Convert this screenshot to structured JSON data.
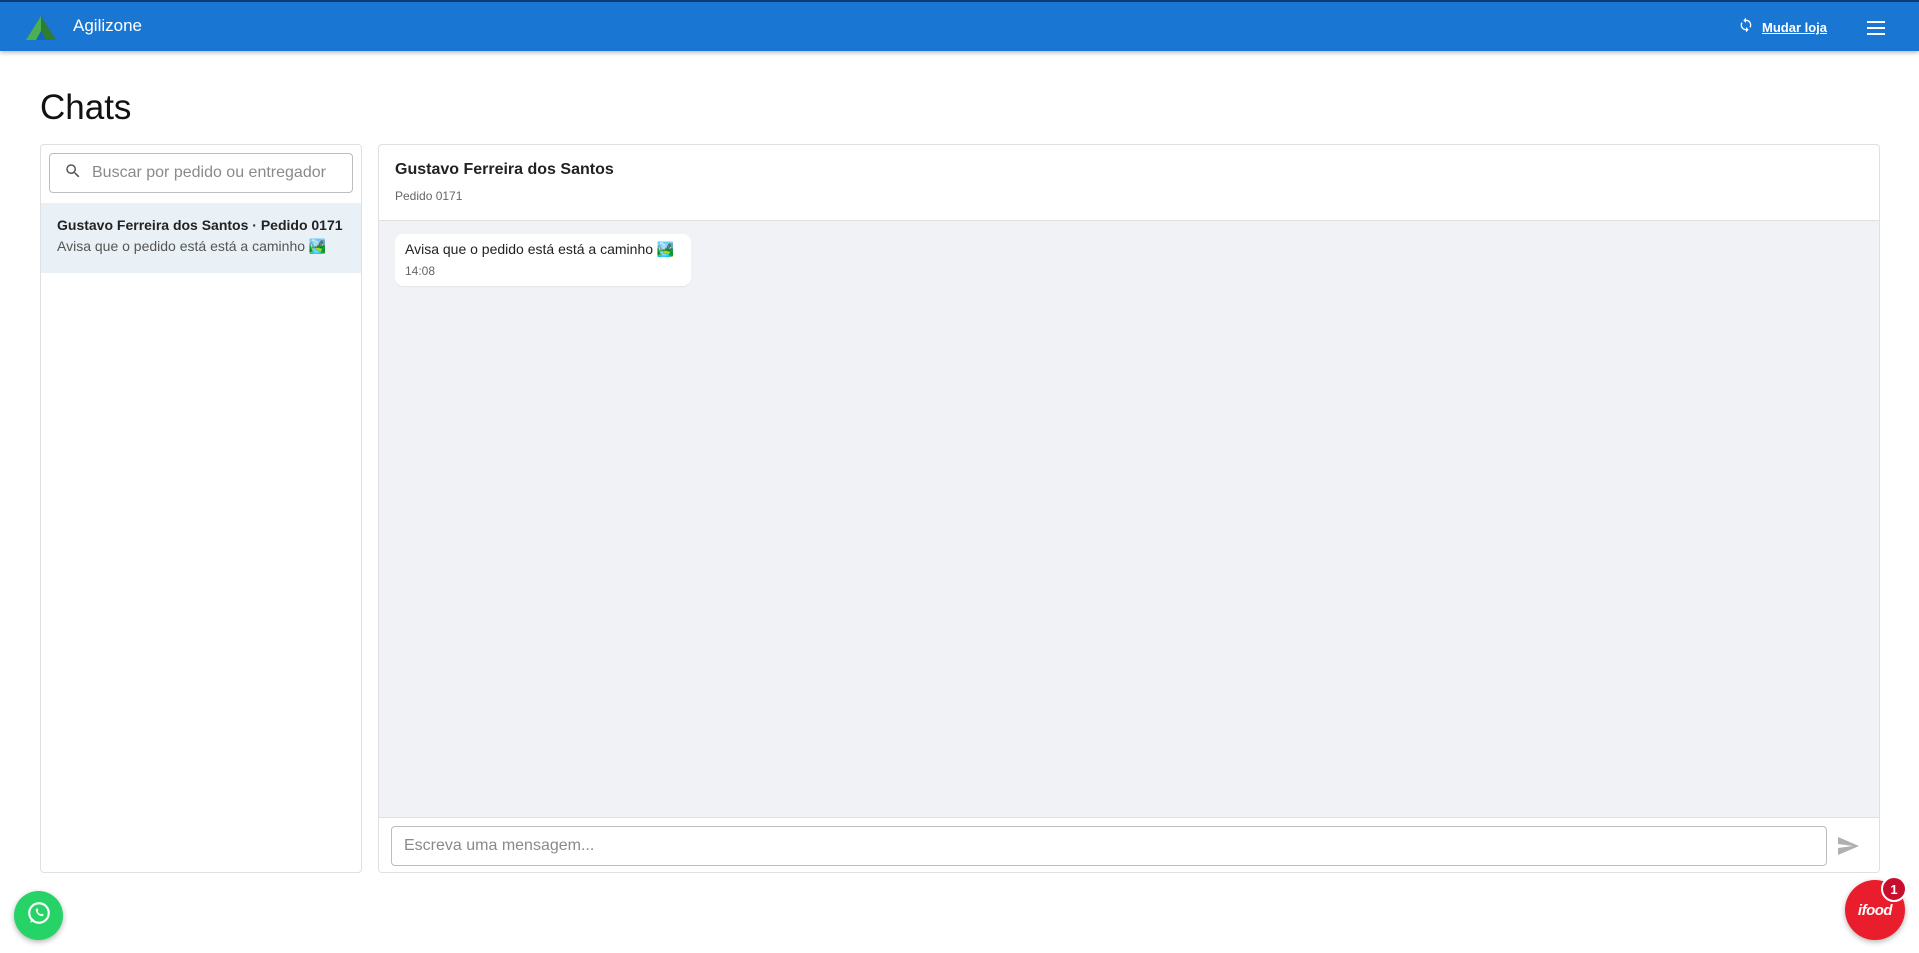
{
  "header": {
    "app_name": "Agilizone",
    "switch_store_label": "Mudar loja",
    "icons": {
      "logo": "agilizone-logo",
      "switch": "sync-icon",
      "menu": "hamburger-menu-icon"
    }
  },
  "page": {
    "title": "Chats"
  },
  "chat_list": {
    "search_placeholder": "Buscar por pedido ou entregador",
    "items": [
      {
        "title": "Gustavo Ferreira dos Santos · Pedido 0171",
        "preview": "Avisa que o pedido está está a caminho 🏞️",
        "selected": true
      }
    ]
  },
  "conversation": {
    "contact_name": "Gustavo Ferreira dos Santos",
    "order_label": "Pedido 0171",
    "messages": [
      {
        "text": "Avisa que o pedido está está a caminho 🏞️",
        "time": "14:08"
      }
    ],
    "composer_placeholder": "Escreva uma mensagem..."
  },
  "floating": {
    "whatsapp_icon": "whatsapp-icon",
    "ifood_label": "ifood",
    "ifood_badge_count": "1"
  },
  "colors": {
    "primary": "#1976d2",
    "selected_item_bg": "#e9f1f6",
    "messages_bg": "#f0f2f5",
    "whatsapp": "#25d366",
    "ifood": "#ea1d2c"
  }
}
